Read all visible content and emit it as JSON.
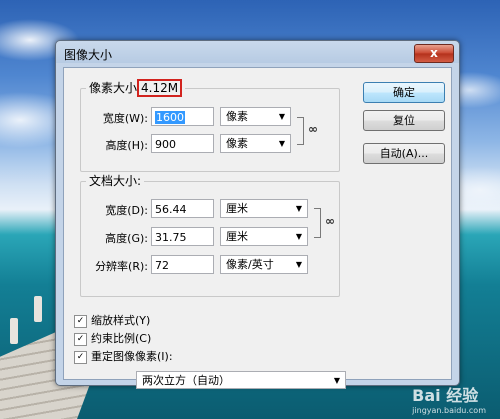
{
  "dialog": {
    "title": "图像大小",
    "close_label": "x"
  },
  "pixel_group": {
    "label": "像素大小",
    "size": "4.12M",
    "width_label": "宽度(W):",
    "width_value": "1600",
    "width_unit": "像素",
    "height_label": "高度(H):",
    "height_value": "900",
    "height_unit": "像素"
  },
  "doc_group": {
    "label": "文档大小:",
    "width_label": "宽度(D):",
    "width_value": "56.44",
    "width_unit": "厘米",
    "height_label": "高度(G):",
    "height_value": "31.75",
    "height_unit": "厘米",
    "resolution_label": "分辨率(R):",
    "resolution_value": "72",
    "resolution_unit": "像素/英寸"
  },
  "buttons": {
    "ok": "确定",
    "reset": "复位",
    "auto": "自动(A)..."
  },
  "options": {
    "scale_styles": "缩放样式(Y)",
    "constrain": "约束比例(C)",
    "resample": "重定图像像素(I):",
    "resample_method": "两次立方（自动）"
  },
  "watermark": {
    "brand": "Bai 经验",
    "url": "jingyan.baidu.com"
  },
  "colors": {
    "highlight": "#d2231e",
    "selection": "#3399ff"
  }
}
